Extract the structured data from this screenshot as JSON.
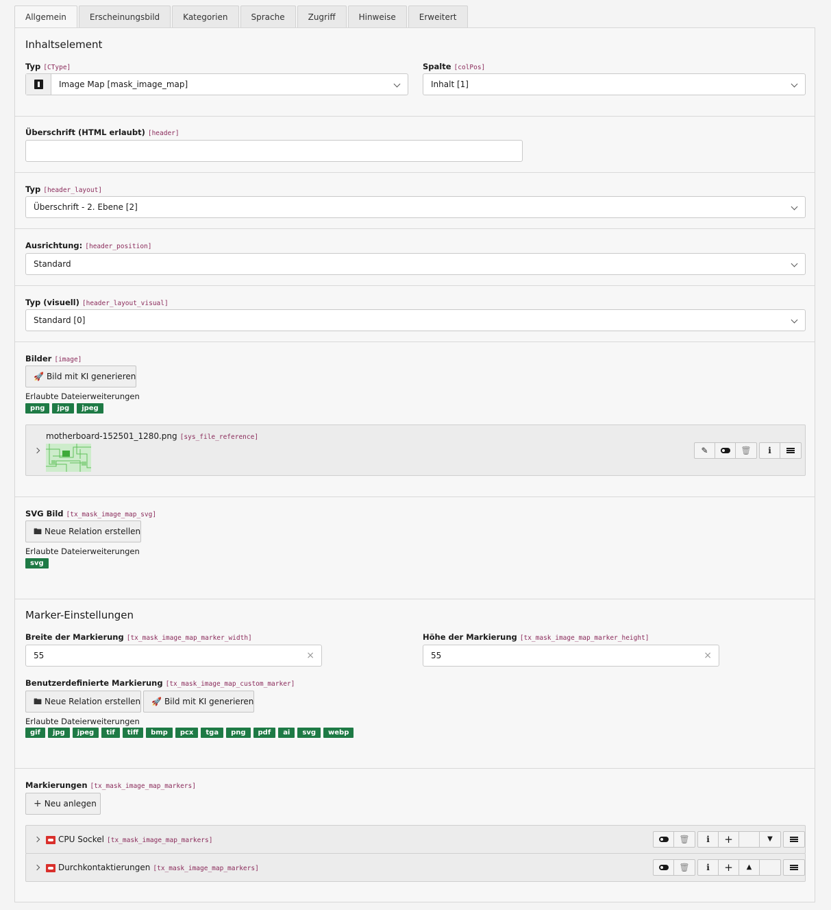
{
  "tabs": [
    "Allgemein",
    "Erscheinungsbild",
    "Kategorien",
    "Sprache",
    "Zugriff",
    "Hinweise",
    "Erweitert"
  ],
  "content_element": {
    "section_title": "Inhaltselement",
    "type_label": "Typ",
    "type_code": "[CType]",
    "type_value": "Image Map [mask_image_map]",
    "column_label": "Spalte",
    "column_code": "[colPos]",
    "column_value": "Inhalt [1]"
  },
  "header": {
    "label": "Überschrift (HTML erlaubt)",
    "code": "[header]",
    "value": ""
  },
  "header_layout": {
    "label": "Typ",
    "code": "[header_layout]",
    "value": "Überschrift - 2. Ebene [2]"
  },
  "header_position": {
    "label": "Ausrichtung:",
    "code": "[header_position]",
    "value": "Standard"
  },
  "header_layout_visual": {
    "label": "Typ (visuell)",
    "code": "[header_layout_visual]",
    "value": "Standard [0]"
  },
  "images": {
    "label": "Bilder",
    "code": "[image]",
    "ai_button": "Bild mit KI generieren",
    "allowed_label": "Erlaubte Dateierweiterungen",
    "extensions": [
      "png",
      "jpg",
      "jpeg"
    ],
    "file": {
      "name": "motherboard-152501_1280.png",
      "code": "[sys_file_reference]"
    }
  },
  "svg_image": {
    "label": "SVG Bild",
    "code": "[tx_mask_image_map_svg]",
    "new_relation_button": "Neue Relation erstellen",
    "allowed_label": "Erlaubte Dateierweiterungen",
    "extensions": [
      "svg"
    ]
  },
  "marker_settings": {
    "section_title": "Marker-Einstellungen",
    "width_label": "Breite der Markierung",
    "width_code": "[tx_mask_image_map_marker_width]",
    "width_value": "55",
    "height_label": "Höhe der Markierung",
    "height_code": "[tx_mask_image_map_marker_height]",
    "height_value": "55",
    "custom_label": "Benutzerdefinierte Markierung",
    "custom_code": "[tx_mask_image_map_custom_marker]",
    "new_relation_button": "Neue Relation erstellen",
    "ai_button": "Bild mit KI generieren",
    "allowed_label": "Erlaubte Dateierweiterungen",
    "extensions": [
      "gif",
      "jpg",
      "jpeg",
      "tif",
      "tiff",
      "bmp",
      "pcx",
      "tga",
      "png",
      "pdf",
      "ai",
      "svg",
      "webp"
    ]
  },
  "markers": {
    "label": "Markierungen",
    "code": "[tx_mask_image_map_markers]",
    "new_button": "Neu anlegen",
    "items": [
      {
        "title": "CPU Sockel",
        "code": "[tx_mask_image_map_markers]"
      },
      {
        "title": "Durchkontaktierungen",
        "code": "[tx_mask_image_map_markers]"
      }
    ]
  },
  "icons": {
    "ctype": "image-map-icon",
    "edit": "pencil-icon",
    "toggle": "toggle-icon",
    "delete": "trash-icon",
    "info": "info-icon",
    "sort": "bars-icon",
    "add": "plus-icon",
    "move_down": "caret-down-icon",
    "move_up": "caret-up-icon",
    "folder": "folder-icon",
    "rocket": "rocket-icon",
    "marker": "marker-record-icon"
  },
  "colors": {
    "badge": "#1e7a45",
    "code": "#8a2a5a",
    "marker_icon": "#d9302c"
  }
}
